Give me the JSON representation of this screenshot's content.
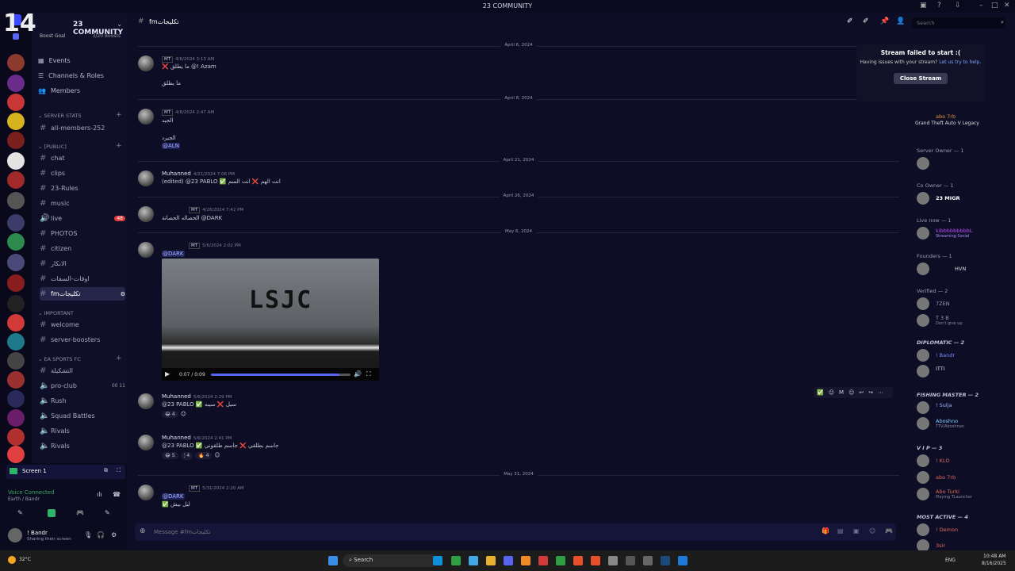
{
  "window": {
    "title": "23 COMMUNITY"
  },
  "server": {
    "name": "23 COMMUNITY",
    "big_count": "14",
    "boost_label": "Boost Goal",
    "boost_count": "3/20 Boosts"
  },
  "nav": [
    {
      "label": "Events"
    },
    {
      "label": "Channels & Roles"
    },
    {
      "label": "Members"
    }
  ],
  "categories": {
    "stats": "SERVER STATS",
    "public": "[PUBLIC]",
    "important": "Important",
    "ea": "EA SPORTS FC"
  },
  "stats_channel": "all-members-252",
  "public_channels": [
    {
      "name": "chat"
    },
    {
      "name": "clips"
    },
    {
      "name": "23-Rules"
    },
    {
      "name": "music"
    },
    {
      "name": "live",
      "badge": "48"
    },
    {
      "name": "PHOTOS"
    },
    {
      "name": "citizen"
    },
    {
      "name": "الانكار"
    },
    {
      "name": "اوقات-السفات"
    },
    {
      "name": "fmتكليجات"
    }
  ],
  "important_channels": [
    {
      "name": "welcome"
    },
    {
      "name": "server-boosters"
    }
  ],
  "ea_channels": [
    {
      "name": "التشكيلة"
    },
    {
      "name": "pro-club",
      "meta": "00 11"
    },
    {
      "name": "Rush"
    },
    {
      "name": "Squad Battles"
    },
    {
      "name": "Rivals"
    },
    {
      "name": "Rivals"
    }
  ],
  "user_panel": {
    "screen": "Screen 1",
    "voice": "Voice Connected",
    "voice_location": "Earth / Bandr",
    "name": "! Bandr",
    "status": "Sharing their screen"
  },
  "channel_header": {
    "name": "fmتكليجات"
  },
  "messages": [
    {
      "date": "April 6, 2024",
      "author": "",
      "time": "4/6/2024 3:13 AM",
      "lines": [
        "❌ ما يطلق @! Azam",
        "ما يطلق"
      ]
    },
    {
      "date": "April 8, 2024",
      "author": "",
      "time": "4/8/2024 2:47 AM",
      "lines": [
        "الجيد",
        "الجيرد",
        "@ALN"
      ]
    },
    {
      "date": "April 21, 2024",
      "author": "Muhanned",
      "time": "4/21/2024 7:06 PM",
      "lines": [
        "(edited) @23 PABLO ✅ انت الهم ❌ انت السم"
      ]
    },
    {
      "date": "April 26, 2024",
      "author": "",
      "time": "4/26/2024 7:42 PM",
      "lines": [
        "الحصاله  الحصانة @DARK"
      ]
    },
    {
      "date": "May 6, 2024",
      "author": "",
      "time": "5/6/2024 2:02 PM",
      "lines": [
        "@DARK"
      ]
    },
    {
      "author": "Muhanned",
      "time": "5/6/2024 2:29 PM",
      "lines": [
        "@23 PABLO ✅ سيل ❌ سيبه"
      ],
      "reactions": [
        "😂 4"
      ]
    },
    {
      "author": "Muhanned",
      "time": "5/6/2024 2:41 PM",
      "lines": [
        "@23 PABLO ✅ جاسم بطلقي ❌ جاسم طلقوني"
      ],
      "reactions": [
        "😂 5",
        "🕯 4",
        "🔥 4"
      ]
    },
    {
      "date": "May 31, 2024",
      "author": "",
      "time": "5/31/2024 2:20 AM",
      "lines": [
        "@DARK",
        "✅ ليل بيش"
      ]
    }
  ],
  "video": {
    "overlay": "LSJC",
    "time": "0:07 / 0:09"
  },
  "composer": {
    "placeholder": "Message #fmتكليجات"
  },
  "search": {
    "placeholder": "Search"
  },
  "popup": {
    "title": "Stream failed to start :(",
    "body": "Having issues with your stream?",
    "link": "Let us try to help.",
    "button": "Close Stream"
  },
  "members": [
    {
      "group": "",
      "name": "abo 7rb",
      "sub": "Grand Theft Auto V Legacy"
    },
    {
      "group": "Server Owner — 1",
      "name": "",
      "sub": ""
    },
    {
      "group": "Co Owner — 1",
      "name": "23 MIGR",
      "sub": ""
    },
    {
      "group": "Live now — 1",
      "name": "kibbbbbbbbbL",
      "sub": "Streaming Social"
    },
    {
      "group": "Founders — 1",
      "name": "HVN",
      "sub": ""
    },
    {
      "group": "Verified — 2",
      "name": "7ZEN",
      "sub": ""
    },
    {
      "group": "",
      "name": "T 3 B",
      "sub": "Don't give up"
    },
    {
      "group": "DIPLOMATIC — 2",
      "name": "! Bandr",
      "sub": ""
    },
    {
      "group": "",
      "name": "ITTI",
      "sub": ""
    },
    {
      "group": "FISHING MASTER — 2",
      "name": "! Sulja",
      "sub": ""
    },
    {
      "group": "",
      "name": "Aboshno",
      "sub": "TTV/Aboshnan"
    },
    {
      "group": "V I P — 3",
      "name": "! KLO",
      "sub": ""
    },
    {
      "group": "",
      "name": "abo 7rb",
      "sub": ""
    },
    {
      "group": "",
      "name": "Abo Turki",
      "sub": "Playing TLauncher"
    },
    {
      "group": "MOST ACTIVE — 4",
      "name": "! Demon",
      "sub": ""
    },
    {
      "group": "",
      "name": "3sir",
      "sub": ""
    }
  ],
  "taskbar": {
    "weather": "32°C",
    "search": "Search",
    "lang": "ENG",
    "time": "10:48 AM",
    "date": "8/16/2025"
  }
}
